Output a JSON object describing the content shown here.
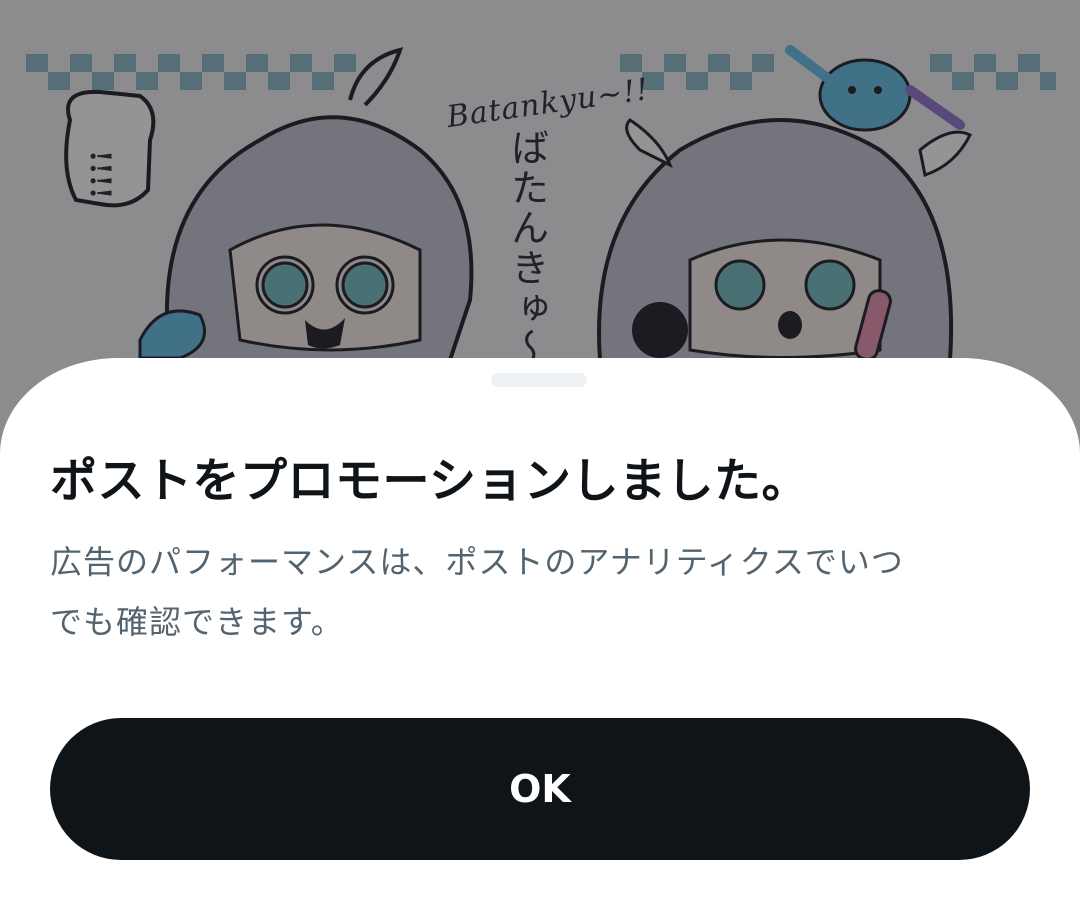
{
  "background": {
    "caption_en": "Batankyu~!!",
    "caption_jp": "ばたんきゅ〜",
    "exclaim": "!!!!",
    "colors": {
      "hair": "#c8c8d6",
      "outline": "#2f2f3a",
      "eyes": "#7fc3c9",
      "bird": "#6ec3e8",
      "checker": "#7fb0c4"
    }
  },
  "sheet": {
    "title": "ポストをプロモーションしました。",
    "description_line1": "広告のパフォーマンスは、ポストのアナリティクスでいつ",
    "description_line2": "でも確認できます。",
    "ok_label": "OK",
    "colors": {
      "button_bg": "#0f1419",
      "button_text": "#ffffff",
      "desc": "#536471"
    }
  }
}
